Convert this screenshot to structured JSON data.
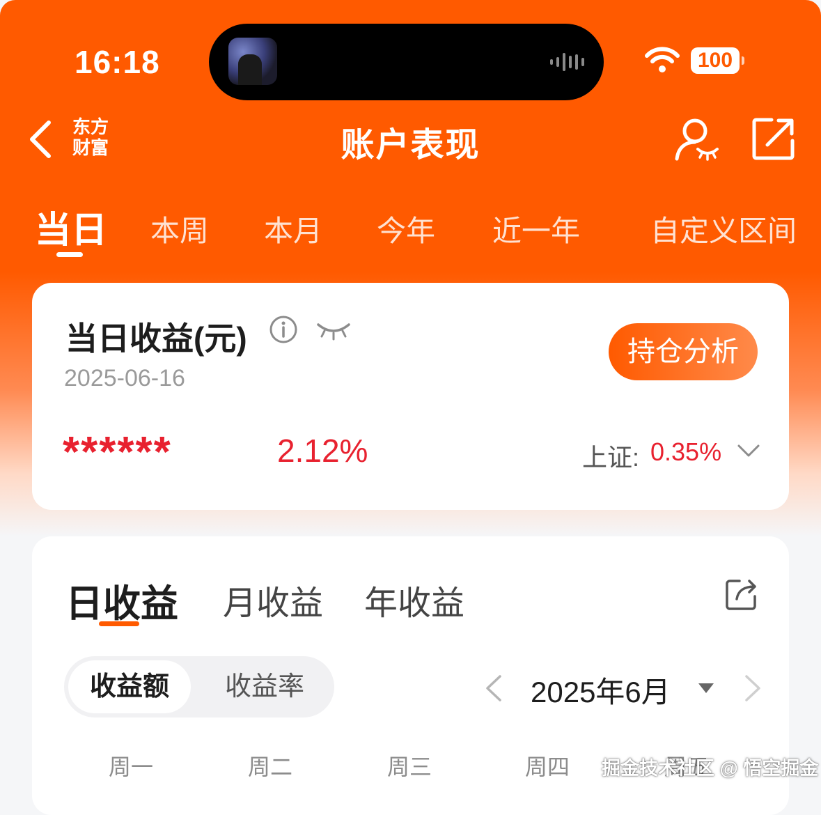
{
  "status_bar": {
    "time": "16:18",
    "battery": "100"
  },
  "nav": {
    "brand_line1": "东方",
    "brand_line2": "财富",
    "title": "账户表现"
  },
  "period_tabs": [
    {
      "label": "当日",
      "active": true
    },
    {
      "label": "本周",
      "active": false
    },
    {
      "label": "本月",
      "active": false
    },
    {
      "label": "今年",
      "active": false
    },
    {
      "label": "近一年",
      "active": false
    },
    {
      "label": "自定义区间",
      "active": false
    }
  ],
  "summary": {
    "title": "当日收益(元)",
    "date": "2025-06-16",
    "hold_button": "持仓分析",
    "amount_masked": "******",
    "return_pct": "2.12%",
    "index_label": "上证:",
    "index_value": "0.35%"
  },
  "earnings": {
    "tabs": [
      {
        "label": "日收益",
        "active": true
      },
      {
        "label": "月收益",
        "active": false
      },
      {
        "label": "年收益",
        "active": false
      }
    ],
    "toggle": [
      {
        "label": "收益额",
        "active": true
      },
      {
        "label": "收益率",
        "active": false
      }
    ],
    "month_label": "2025年6月",
    "weekdays": [
      "周一",
      "周二",
      "周三",
      "周四",
      "周五"
    ]
  },
  "watermark": "掘金技术社区 @ 悟空掘金",
  "colors": {
    "brand": "#ff5a00",
    "up_red": "#e8212f",
    "background": "#f5f6f8"
  },
  "icons": [
    "back-arrow-icon",
    "user-eye-icon",
    "share-icon",
    "info-icon",
    "eye-closed-icon",
    "chevron-down-icon",
    "export-icon",
    "chevron-left-icon",
    "caret-down-icon",
    "chevron-right-icon",
    "wifi-icon",
    "battery-icon"
  ]
}
